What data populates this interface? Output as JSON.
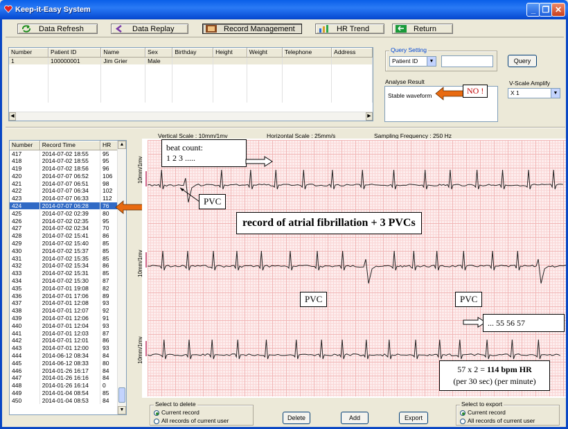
{
  "window": {
    "title": "Keep-it-Easy System"
  },
  "toolbar": {
    "refresh": "Data Refresh",
    "replay": "Data Replay",
    "record_mgmt": "Record Management",
    "hr_trend": "HR Trend",
    "return": "Return"
  },
  "patient_table": {
    "headers": [
      "Number",
      "Patient ID",
      "Name",
      "Sex",
      "Birthday",
      "Height",
      "Weight",
      "Telephone",
      "Address"
    ],
    "rows": [
      [
        "1",
        "100000001",
        "Jim Grier",
        "Male",
        "",
        "",
        "",
        "",
        ""
      ]
    ]
  },
  "query": {
    "group_label": "Query Setting",
    "field": "Patient ID",
    "value": "",
    "button": "Query"
  },
  "analyse": {
    "label": "Analyse Result",
    "value": "Stable waveform"
  },
  "vscale": {
    "label": "V-Scale Amplify",
    "value": "X 1"
  },
  "scale_info": {
    "vertical": "Vertical Scale :  10mm/1mv",
    "horizontal": "Horizontal Scale :  25mm/s",
    "sampling": "Sampling Frequency :    250 Hz"
  },
  "record_table": {
    "headers": [
      "Number",
      "Record Time",
      "HR"
    ],
    "selected_number": "424",
    "rows": [
      [
        "417",
        "2014-07-02 18:55",
        "95"
      ],
      [
        "418",
        "2014-07-02 18:55",
        "95"
      ],
      [
        "419",
        "2014-07-02 18:56",
        "96"
      ],
      [
        "420",
        "2014-07-07 06:52",
        "106"
      ],
      [
        "421",
        "2014-07-07 06:51",
        "98"
      ],
      [
        "422",
        "2014-07-07 06:34",
        "102"
      ],
      [
        "423",
        "2014-07-07 06:33",
        "112"
      ],
      [
        "424",
        "2014-07-07 06:28",
        "76"
      ],
      [
        "425",
        "2014-07-02 02:39",
        "80"
      ],
      [
        "426",
        "2014-07-02 02:35",
        "95"
      ],
      [
        "427",
        "2014-07-02 02:34",
        "70"
      ],
      [
        "428",
        "2014-07-02 15:41",
        "86"
      ],
      [
        "429",
        "2014-07-02 15:40",
        "85"
      ],
      [
        "430",
        "2014-07-02 15:37",
        "85"
      ],
      [
        "431",
        "2014-07-02 15:35",
        "85"
      ],
      [
        "432",
        "2014-07-02 15:34",
        "86"
      ],
      [
        "433",
        "2014-07-02 15:31",
        "85"
      ],
      [
        "434",
        "2014-07-02 15:30",
        "87"
      ],
      [
        "435",
        "2014-07-01 19:08",
        "82"
      ],
      [
        "436",
        "2014-07-01 17:06",
        "89"
      ],
      [
        "437",
        "2014-07-01 12:08",
        "93"
      ],
      [
        "438",
        "2014-07-01 12:07",
        "92"
      ],
      [
        "439",
        "2014-07-01 12:06",
        "91"
      ],
      [
        "440",
        "2014-07-01 12:04",
        "93"
      ],
      [
        "441",
        "2014-07-01 12:03",
        "87"
      ],
      [
        "442",
        "2014-07-01 12:01",
        "86"
      ],
      [
        "443",
        "2014-07-01 12:00",
        "93"
      ],
      [
        "444",
        "2014-06-12 08:34",
        "84"
      ],
      [
        "445",
        "2014-06-12 08:33",
        "80"
      ],
      [
        "446",
        "2014-01-26 16:17",
        "84"
      ],
      [
        "447",
        "2014-01-26 16:16",
        "84"
      ],
      [
        "448",
        "2014-01-26 16:14",
        "0"
      ],
      [
        "449",
        "2014-01-04 08:54",
        "85"
      ],
      [
        "450",
        "2014-01-04 08:53",
        "84"
      ]
    ]
  },
  "ecg": {
    "lead_label": "10mm/1mv",
    "annotations": {
      "beat_count_title": "beat count:",
      "beat_count_nums": "1       2         3 .....",
      "pvc": "PVC",
      "main_title": "record of atrial fibrillation + 3 PVCs",
      "tail_count": "...   55   56       57",
      "calc_line1_prefix": "57 x 2 = ",
      "calc_line1_bold": "114 bpm HR",
      "calc_line2": "(per 30 sec)  (per minute)",
      "no": "NO !"
    }
  },
  "delete_group": {
    "label": "Select to delete",
    "opt1": "Current record",
    "opt2": "All records of current user"
  },
  "export_group": {
    "label": "Select to export",
    "opt1": "Current record",
    "opt2": "All records of current user"
  },
  "buttons": {
    "delete": "Delete",
    "add": "Add",
    "export": "Export"
  },
  "colors": {
    "accent": "#316ac5",
    "callout_red": "#c00000",
    "arrow_orange": "#e86a10",
    "ecg_trace": "#202020"
  }
}
